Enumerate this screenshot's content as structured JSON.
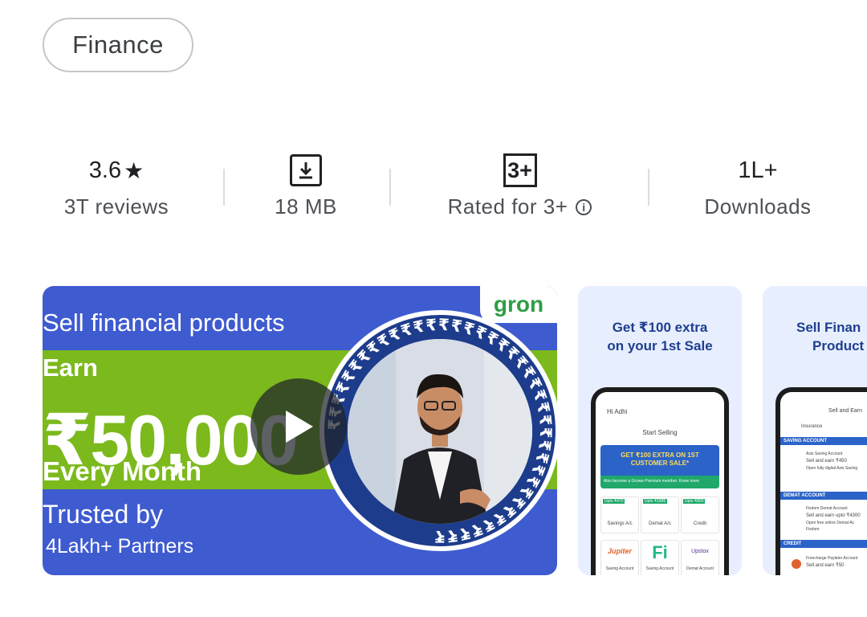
{
  "category_chip": "Finance",
  "stats": {
    "rating": {
      "value": "3.6",
      "star": "★",
      "label": "3T reviews"
    },
    "size": {
      "label": "18 MB",
      "icon": "download-icon"
    },
    "content_rating": {
      "badge": "3+",
      "label": "Rated for 3+",
      "info": "i"
    },
    "downloads": {
      "value": "1L+",
      "label": "Downloads"
    }
  },
  "screenshots": {
    "video": {
      "line1": "Sell financial products",
      "line2": "Earn",
      "line3": "₹50,000",
      "line4": "Every Month",
      "line5": "Trusted by",
      "line6": "4Lakh+ Partners",
      "logo": "gron",
      "ring_text": "₹₹₹₹₹₹₹₹₹₹₹₹₹₹₹₹₹₹₹₹₹₹₹₹₹₹₹₹₹₹₹₹₹₹₹₹₹₹₹₹"
    },
    "card2": {
      "title_line1": "Get ₹100 extra",
      "title_line2": "on your 1st Sale",
      "greeting": "Hi Adhi",
      "section": "Start Selling",
      "banner_line1": "GET ₹100 EXTRA ON 1ST",
      "banner_line2": "CUSTOMER SALE*",
      "banner_sub": "Also become a Groww Premium member. Know more",
      "tiles": [
        "Savings A/c",
        "Demat A/c",
        "Credit"
      ],
      "tile_badges": [
        "Upto ₹470",
        "Upto ₹1885",
        "Upto ₹800"
      ],
      "brands": [
        "Jupiter",
        "Fi",
        "Upstox"
      ],
      "brand_sub": [
        "Saving Account",
        "Saving Account",
        "Demat Account"
      ]
    },
    "card3": {
      "title_line1": "Sell Finan",
      "title_line2": "Product",
      "header": "Sell and Earn",
      "tab": "Insurance",
      "sections": [
        "SAVING ACCOUNT",
        "DEMAT ACCOUNT",
        "CREDIT"
      ],
      "row1_a": "Axis Saving Account",
      "row1_b": "Sell and earn ₹450",
      "row1_c": "Open fully digital Axis Saving",
      "row2_a": "Fisdom Demat Account",
      "row2_b": "Sell and earn upto ₹4300",
      "row2_c": "Open free online Demat Ac",
      "row2_d": "Fisdom",
      "row3_a": "Freecharge Paylater Account",
      "row3_b": "Sell and earn ₹50"
    }
  },
  "colors": {
    "accent_blue": "#3f5bd0",
    "accent_green": "#7cb91d",
    "card_bg": "#e7eefe"
  }
}
